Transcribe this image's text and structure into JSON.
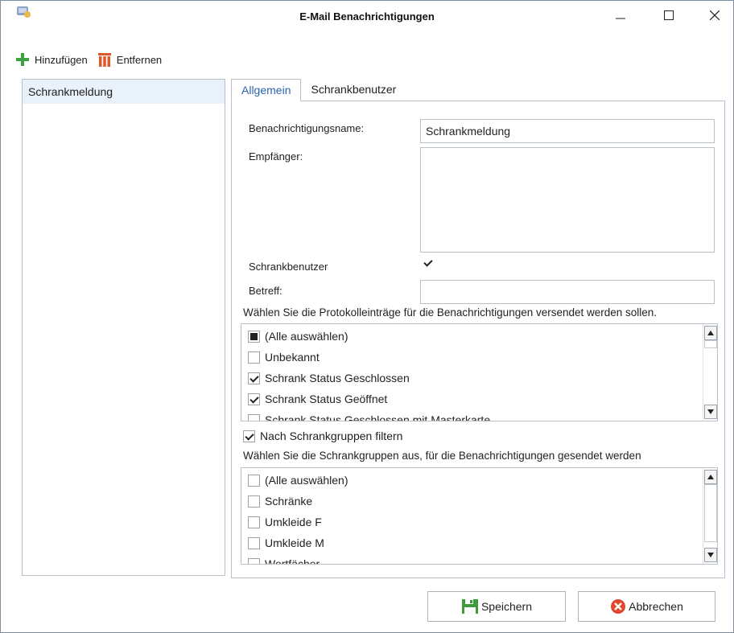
{
  "window": {
    "title": "E-Mail Benachrichtigungen",
    "controls": {
      "minimize": "—",
      "maximize": "☐",
      "close": "✕"
    }
  },
  "toolbar": {
    "add_label": "Hinzufügen",
    "remove_label": "Entfernen"
  },
  "notifications": {
    "items": [
      {
        "label": "Schrankmeldung",
        "selected": true
      }
    ]
  },
  "tabs": [
    {
      "label": "Allgemein",
      "active": true
    },
    {
      "label": "Schrankbenutzer",
      "active": false
    }
  ],
  "form": {
    "name_label": "Benachrichtigungsname:",
    "name_value": "Schrankmeldung",
    "recipients_label": "Empfänger:",
    "recipients_value": "",
    "locker_user_label": "Schrankbenutzer",
    "locker_user_checked": true,
    "subject_label": "Betreff:",
    "subject_value": "",
    "log_entries_instruction": "Wählen Sie die Protokolleinträge für die Benachrichtigungen versendet werden sollen.",
    "log_entries": [
      {
        "label": "(Alle auswählen)",
        "state": "indeterminate"
      },
      {
        "label": "Unbekannt",
        "state": "unchecked"
      },
      {
        "label": "Schrank Status Geschlossen",
        "state": "checked"
      },
      {
        "label": "Schrank Status Geöffnet",
        "state": "checked"
      },
      {
        "label": "Schrank Status Geschlossen mit Masterkarte",
        "state": "unchecked"
      }
    ],
    "filter_by_group_label": "Nach Schrankgruppen filtern",
    "filter_by_group_checked": true,
    "groups_instruction": "Wählen Sie die Schrankgruppen aus, für die Benachrichtigungen gesendet werden",
    "groups": [
      {
        "label": "(Alle auswählen)",
        "state": "unchecked"
      },
      {
        "label": "Schränke",
        "state": "unchecked"
      },
      {
        "label": "Umkleide F",
        "state": "unchecked"
      },
      {
        "label": "Umkleide M",
        "state": "unchecked"
      },
      {
        "label": "Wertfächer",
        "state": "unchecked"
      }
    ]
  },
  "buttons": {
    "save_label": "Speichern",
    "cancel_label": "Abbrechen"
  },
  "colors": {
    "accent": "#2b63b0",
    "add_icon": "#3da23d",
    "remove_icon": "#e0572a",
    "save_icon": "#3e9b3e",
    "cancel_icon": "#e04a2c",
    "selection": "#e9f1fb"
  }
}
